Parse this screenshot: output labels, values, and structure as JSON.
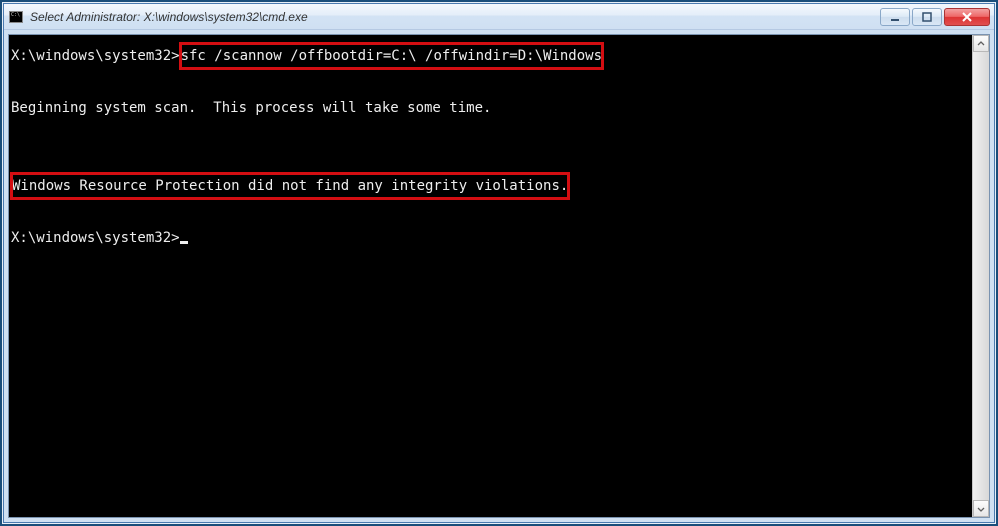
{
  "window": {
    "title": "Select Administrator: X:\\windows\\system32\\cmd.exe"
  },
  "terminal": {
    "prompt1_prefix": "X:\\windows\\system32>",
    "command_highlighted": "sfc /scannow /offbootdir=C:\\ /offwindir=D:\\Windows",
    "blank1": "",
    "scan_line": "Beginning system scan.  This process will take some time.",
    "blank2": "",
    "blank3": "",
    "result_highlighted": "Windows Resource Protection did not find any integrity violations.",
    "blank4": "",
    "prompt2": "X:\\windows\\system32>"
  }
}
